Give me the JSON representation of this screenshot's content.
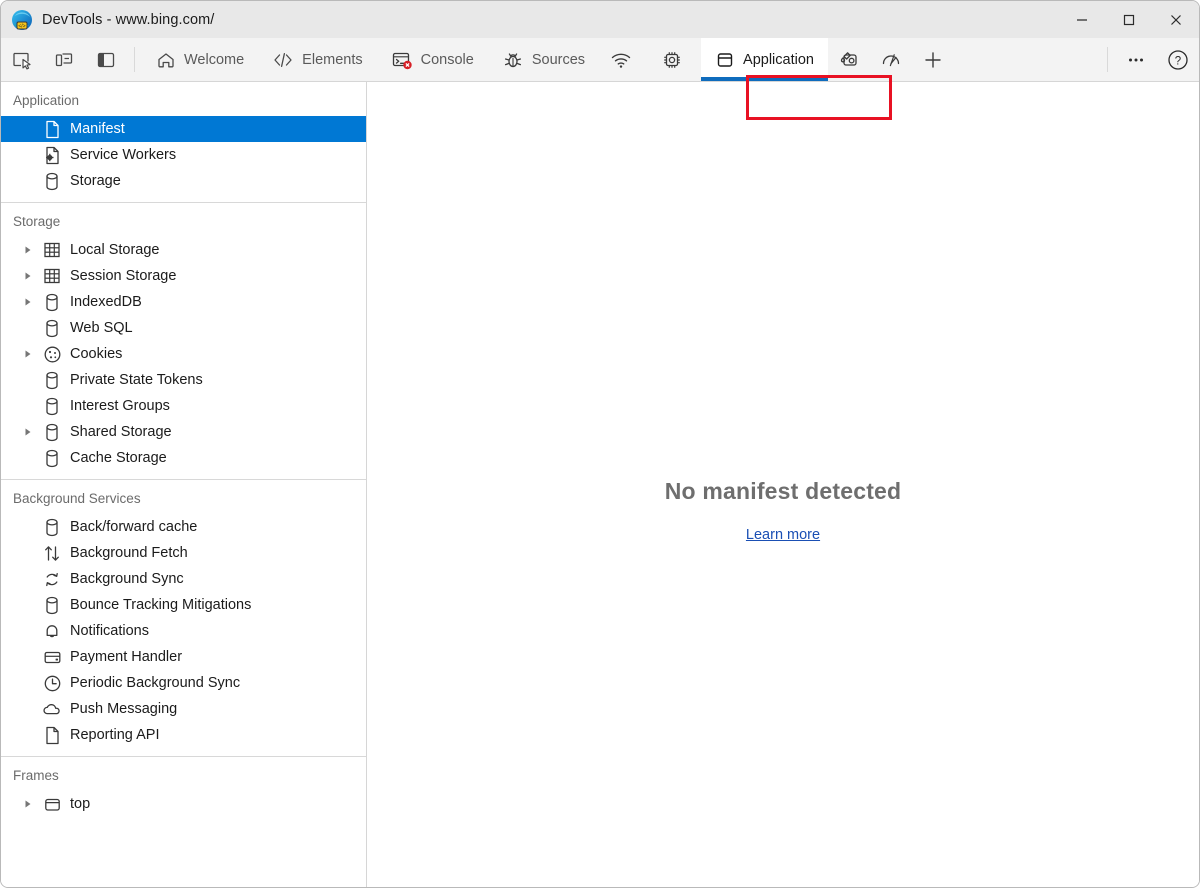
{
  "window": {
    "title": "DevTools - www.bing.com/",
    "logo_icon": "edge-devtools-logo",
    "controls": [
      {
        "name": "minimize-button",
        "icon": "minimize-icon"
      },
      {
        "name": "maximize-button",
        "icon": "maximize-icon"
      },
      {
        "name": "close-button",
        "icon": "close-icon"
      }
    ]
  },
  "toolbar": {
    "left_icons": [
      {
        "name": "inspect-element-button",
        "icon": "inspect-cursor-icon"
      },
      {
        "name": "device-toolbar-button",
        "icon": "device-toggle-icon"
      },
      {
        "name": "dock-side-button",
        "icon": "panel-layout-icon"
      }
    ],
    "tabs": [
      {
        "label": "Welcome",
        "icon": "home-icon",
        "active": false
      },
      {
        "label": "Elements",
        "icon": "code-brackets-icon",
        "active": false
      },
      {
        "label": "Console",
        "icon": "console-error-icon",
        "active": false
      },
      {
        "label": "Sources",
        "icon": "bug-icon",
        "active": false
      },
      {
        "label": "",
        "icon": "network-wifi-icon",
        "active": false
      },
      {
        "label": "",
        "icon": "memory-chip-icon",
        "active": false
      },
      {
        "label": "Application",
        "icon": "application-window-icon",
        "active": true
      }
    ],
    "right_icons": [
      {
        "name": "eyedropper-button",
        "icon": "eyedropper-icon"
      },
      {
        "name": "performance-insights-button",
        "icon": "performance-gauge-icon"
      },
      {
        "name": "add-panel-button",
        "icon": "plus-icon"
      }
    ],
    "overflow": [
      {
        "name": "more-tools-button",
        "icon": "ellipsis-icon"
      },
      {
        "name": "help-button",
        "icon": "question-mark-icon"
      }
    ],
    "highlight_color": "#e81123",
    "active_underline_color": "#0f6cbd"
  },
  "sidebar": {
    "selection_color": "#0078d4",
    "sections": [
      {
        "title": "Application",
        "items": [
          {
            "label": "Manifest",
            "icon": "document-icon",
            "expandable": false,
            "selected": true
          },
          {
            "label": "Service Workers",
            "icon": "service-worker-icon",
            "expandable": false,
            "selected": false
          },
          {
            "label": "Storage",
            "icon": "database-icon",
            "expandable": false,
            "selected": false
          }
        ]
      },
      {
        "title": "Storage",
        "items": [
          {
            "label": "Local Storage",
            "icon": "grid-table-icon",
            "expandable": true,
            "selected": false
          },
          {
            "label": "Session Storage",
            "icon": "grid-table-icon",
            "expandable": true,
            "selected": false
          },
          {
            "label": "IndexedDB",
            "icon": "database-icon",
            "expandable": true,
            "selected": false
          },
          {
            "label": "Web SQL",
            "icon": "database-icon",
            "expandable": false,
            "selected": false
          },
          {
            "label": "Cookies",
            "icon": "cookie-icon",
            "expandable": true,
            "selected": false
          },
          {
            "label": "Private State Tokens",
            "icon": "database-icon",
            "expandable": false,
            "selected": false
          },
          {
            "label": "Interest Groups",
            "icon": "database-icon",
            "expandable": false,
            "selected": false
          },
          {
            "label": "Shared Storage",
            "icon": "database-icon",
            "expandable": true,
            "selected": false
          },
          {
            "label": "Cache Storage",
            "icon": "database-icon",
            "expandable": false,
            "selected": false
          }
        ]
      },
      {
        "title": "Background Services",
        "items": [
          {
            "label": "Back/forward cache",
            "icon": "database-icon",
            "expandable": false,
            "selected": false
          },
          {
            "label": "Background Fetch",
            "icon": "arrows-up-down-icon",
            "expandable": false,
            "selected": false
          },
          {
            "label": "Background Sync",
            "icon": "sync-circular-arrows-icon",
            "expandable": false,
            "selected": false
          },
          {
            "label": "Bounce Tracking Mitigations",
            "icon": "database-icon",
            "expandable": false,
            "selected": false
          },
          {
            "label": "Notifications",
            "icon": "bell-icon",
            "expandable": false,
            "selected": false
          },
          {
            "label": "Payment Handler",
            "icon": "credit-card-icon",
            "expandable": false,
            "selected": false
          },
          {
            "label": "Periodic Background Sync",
            "icon": "clock-icon",
            "expandable": false,
            "selected": false
          },
          {
            "label": "Push Messaging",
            "icon": "cloud-icon",
            "expandable": false,
            "selected": false
          },
          {
            "label": "Reporting API",
            "icon": "document-icon",
            "expandable": false,
            "selected": false
          }
        ]
      },
      {
        "title": "Frames",
        "items": [
          {
            "label": "top",
            "icon": "frame-window-icon",
            "expandable": true,
            "selected": false
          }
        ]
      }
    ]
  },
  "main": {
    "empty_title": "No manifest detected",
    "learn_more": "Learn more",
    "link_color": "#1a4fb4"
  }
}
